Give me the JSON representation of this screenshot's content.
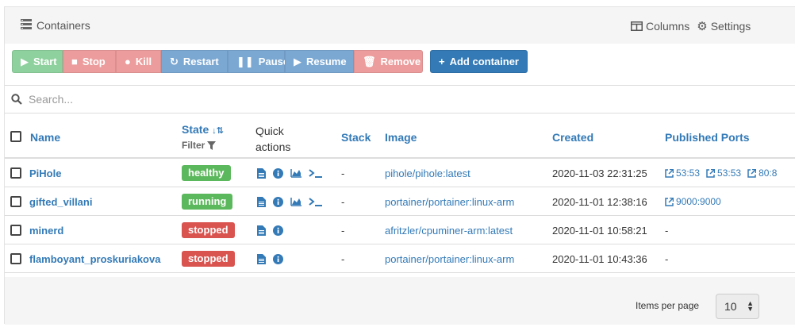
{
  "header": {
    "title": "Containers",
    "columns_label": "Columns",
    "settings_label": "Settings"
  },
  "actions": {
    "start": "Start",
    "stop": "Stop",
    "kill": "Kill",
    "restart": "Restart",
    "pause": "Pause",
    "resume": "Resume",
    "remove": "Remove",
    "add": "Add container"
  },
  "search": {
    "placeholder": "Search..."
  },
  "columns": {
    "name": "Name",
    "state": "State",
    "filter": "Filter",
    "quick_actions": "Quick actions",
    "stack": "Stack",
    "image": "Image",
    "created": "Created",
    "published_ports": "Published Ports"
  },
  "rows": [
    {
      "name": "PiHole",
      "state": "healthy",
      "state_color": "#5cb85c",
      "stack": "-",
      "image": "pihole/pihole:latest",
      "created": "2020-11-03 22:31:25",
      "ports": [
        "53:53",
        "53:53",
        "80:8"
      ],
      "ports_dash": ""
    },
    {
      "name": "gifted_villani",
      "state": "running",
      "state_color": "#5cb85c",
      "stack": "-",
      "image": "portainer/portainer:linux-arm",
      "created": "2020-11-01 12:38:16",
      "ports": [
        "9000:9000"
      ],
      "ports_dash": ""
    },
    {
      "name": "minerd",
      "state": "stopped",
      "state_color": "#d9534f",
      "stack": "-",
      "image": "afritzler/cpuminer-arm:latest",
      "created": "2020-11-01 10:58:21",
      "ports": [],
      "ports_dash": "-"
    },
    {
      "name": "flamboyant_proskuriakova",
      "state": "stopped",
      "state_color": "#d9534f",
      "stack": "-",
      "image": "portainer/portainer:linux-arm",
      "created": "2020-11-01 10:43:36",
      "ports": [],
      "ports_dash": "-"
    }
  ],
  "pagination": {
    "items_per_page_label": "Items per page",
    "items_per_page_value": "10"
  }
}
